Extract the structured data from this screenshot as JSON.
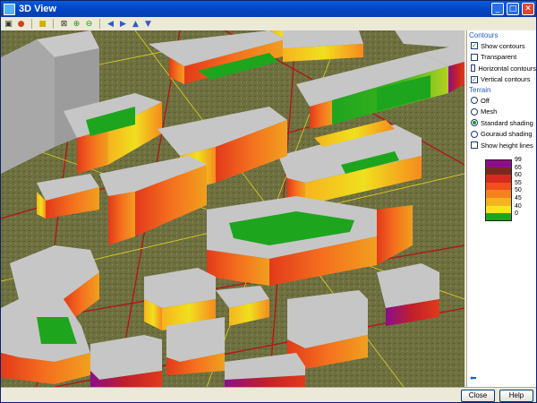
{
  "window": {
    "title": "3D View",
    "controls": {
      "minimize": "_",
      "maximize": "□",
      "close": "✕"
    }
  },
  "toolbar": {
    "icons": [
      "frame-icon",
      "palette-icon",
      "light-icon",
      "fit-view-icon",
      "zoom-in-icon",
      "zoom-out-icon",
      "arrow-left-icon",
      "arrow-right-icon",
      "arrow-up-icon",
      "arrow-down-icon"
    ]
  },
  "panel": {
    "contours": {
      "label": "Contours",
      "options": [
        {
          "label": "Show contours",
          "checked": true
        },
        {
          "label": "Transparent",
          "checked": false
        },
        {
          "label": "Horizontal contours",
          "checked": false
        },
        {
          "label": "Vertical contours",
          "checked": true
        }
      ]
    },
    "terrain": {
      "label": "Terrain",
      "options": [
        {
          "label": "Off",
          "selected": false
        },
        {
          "label": "Mesh",
          "selected": false
        },
        {
          "label": "Standard shading",
          "selected": true
        },
        {
          "label": "Gouraud shading",
          "selected": false
        }
      ],
      "height_lines": {
        "label": "Show height lines",
        "checked": false
      }
    },
    "legend": [
      {
        "value": "99",
        "color": "#8b0f8b"
      },
      {
        "value": "65",
        "color": "#7a2a1c"
      },
      {
        "value": "60",
        "color": "#d72a1c"
      },
      {
        "value": "55",
        "color": "#f0501c"
      },
      {
        "value": "50",
        "color": "#f5821e"
      },
      {
        "value": "45",
        "color": "#f5b41e"
      },
      {
        "value": "40",
        "color": "#f5e61e"
      },
      {
        "value": "0",
        "color": "#1ea51e"
      }
    ]
  },
  "buttons": {
    "close": "Close",
    "help": "Help"
  }
}
